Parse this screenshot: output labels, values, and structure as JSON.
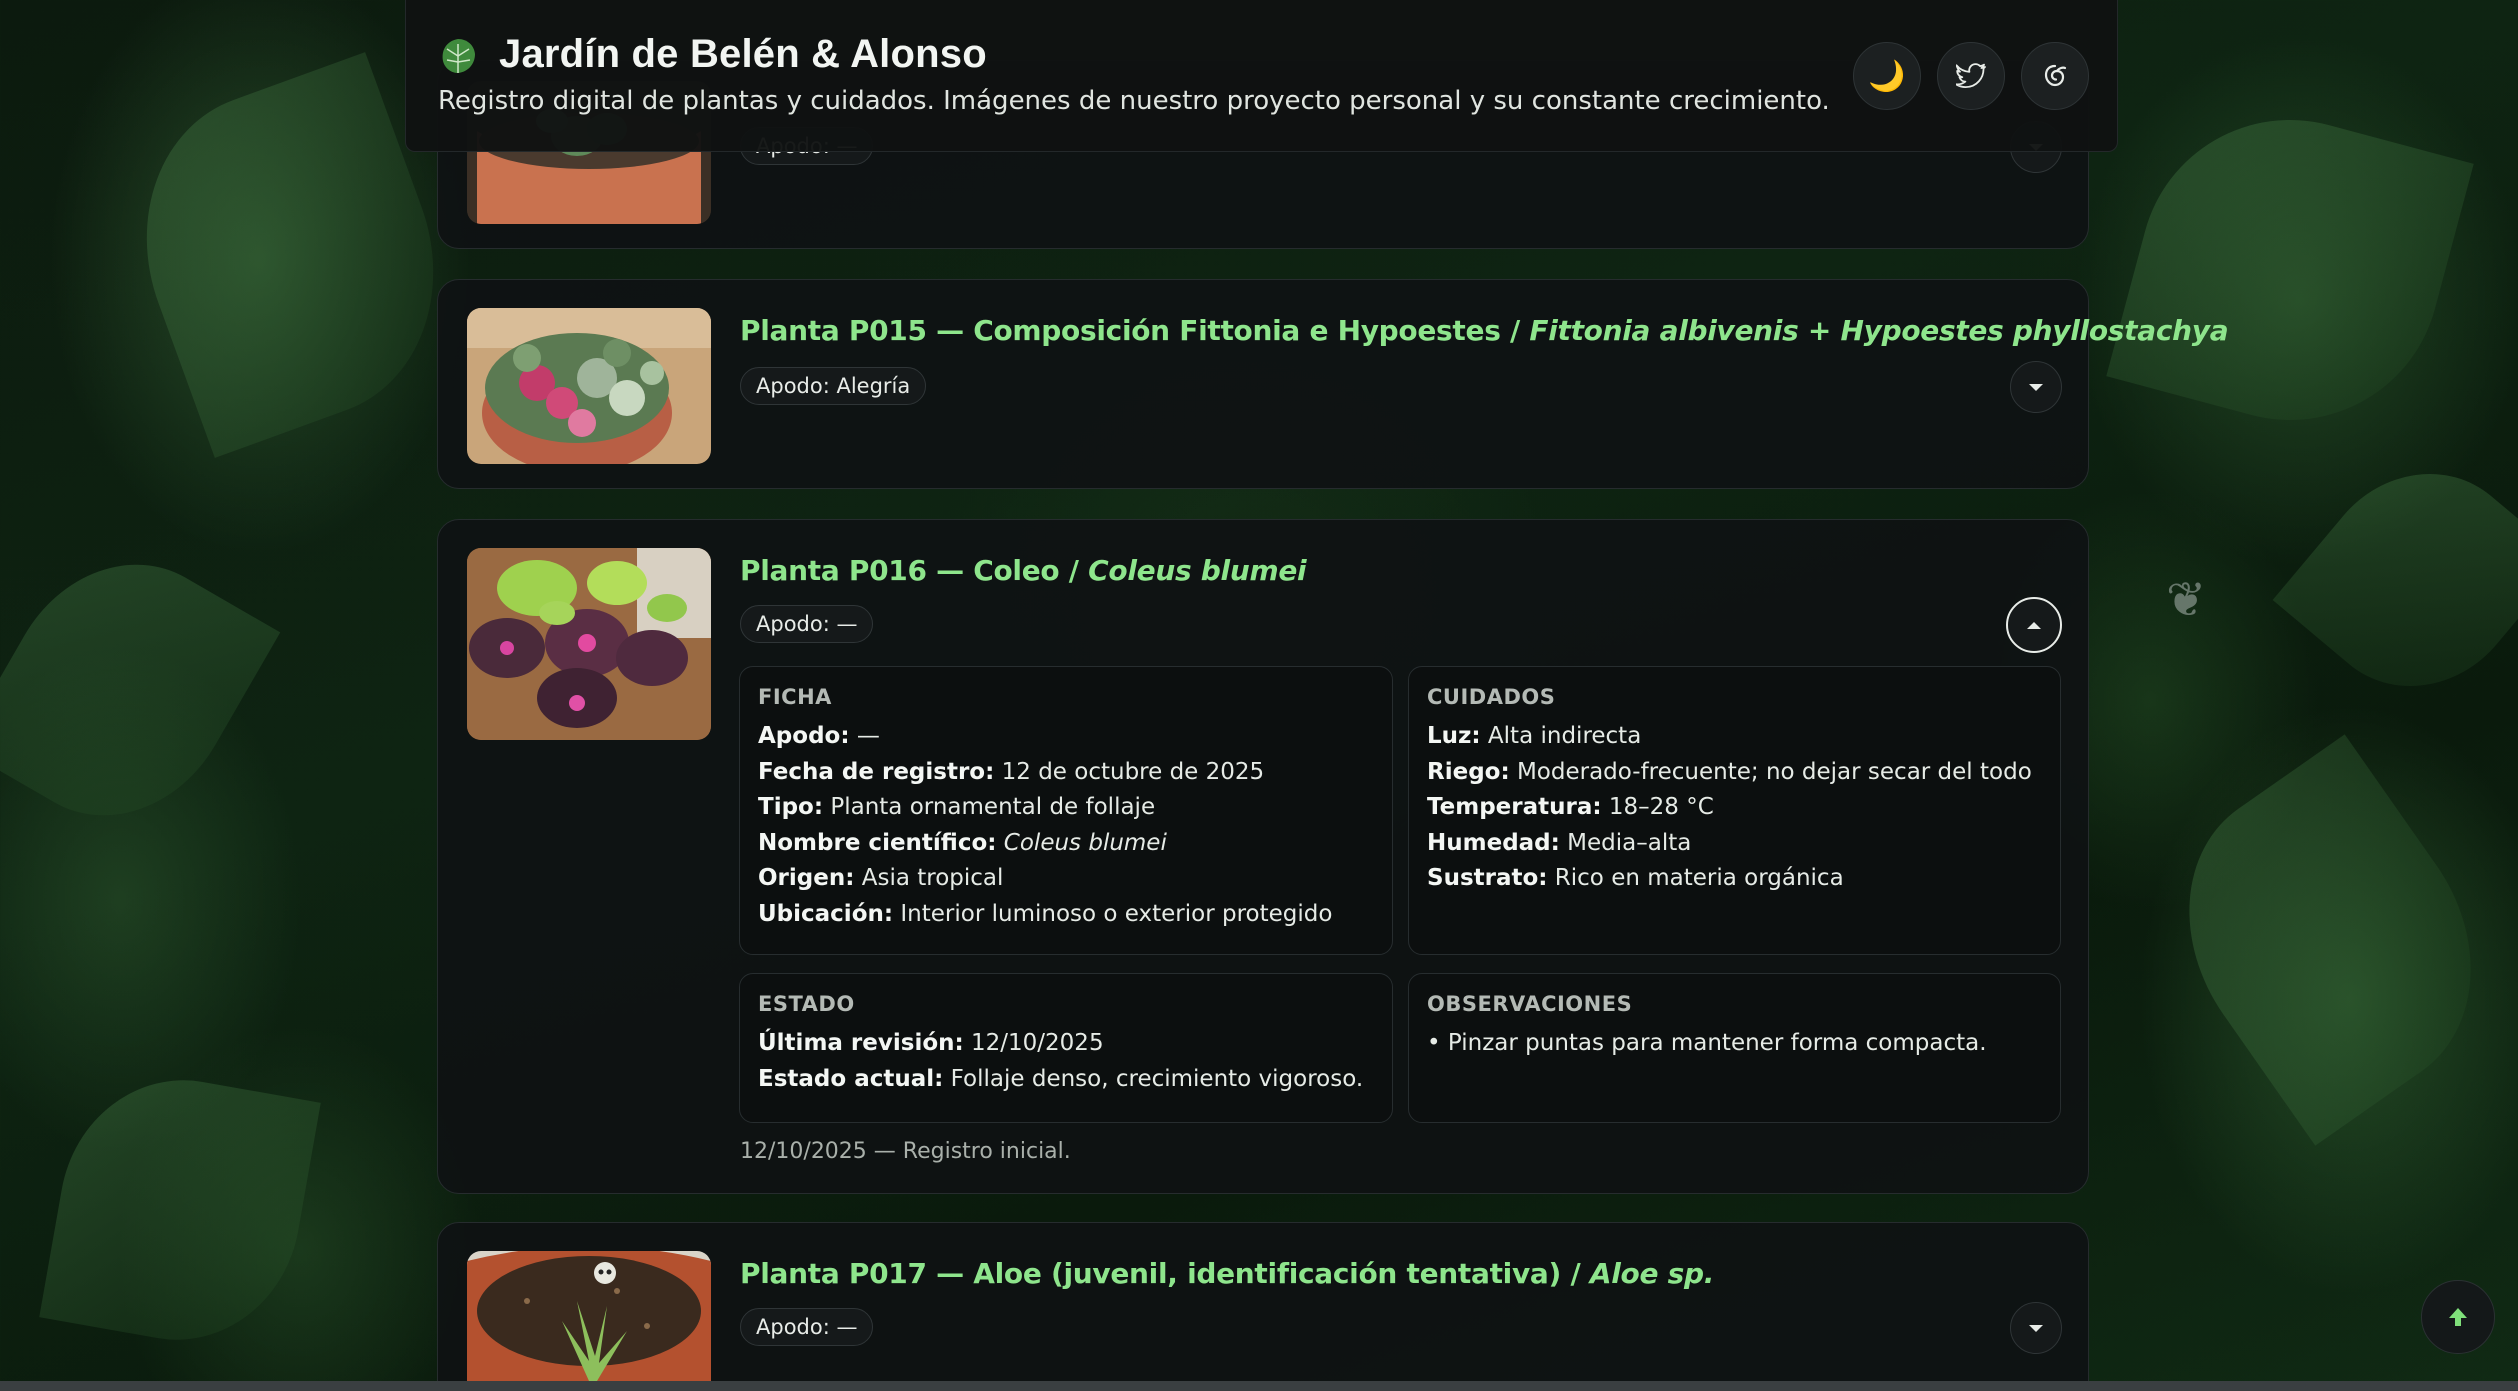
{
  "header": {
    "logo_icon": "monstera-leaf",
    "title": "Jardín de Belén & Alonso",
    "subtitle": "Registro digital de plantas y cuidados. Imágenes de nuestro proyecto personal y su constante crecimiento.",
    "buttons": [
      {
        "icon": "moon-icon",
        "glyph": "🌙"
      },
      {
        "icon": "twitter-icon",
        "glyph": ""
      },
      {
        "icon": "bluesky-icon",
        "glyph": ""
      }
    ]
  },
  "cards": {
    "p014": {
      "apodo": "Apodo: —"
    },
    "p015": {
      "title_prefix": "Planta P015 — Composición Fittonia e Hypoestes / ",
      "title_sci": "Fittonia albivenis + Hypoestes phyllostachya",
      "apodo": "Apodo: Alegría"
    },
    "p016": {
      "title_prefix": "Planta P016 — Coleo / ",
      "title_sci": "Coleus blumei",
      "apodo": "Apodo: —",
      "ficha": {
        "heading": "FICHA",
        "rows": [
          {
            "k": "Apodo:",
            "v": " —"
          },
          {
            "k": "Fecha de registro:",
            "v": " 12 de octubre de 2025"
          },
          {
            "k": "Tipo:",
            "v": " Planta ornamental de follaje"
          },
          {
            "k": "Nombre científico:",
            "v": "Coleus blumei"
          },
          {
            "k": "Origen:",
            "v": " Asia tropical"
          },
          {
            "k": "Ubicación:",
            "v": " Interior luminoso o exterior protegido"
          }
        ]
      },
      "cuidados": {
        "heading": "CUIDADOS",
        "rows": [
          {
            "k": "Luz:",
            "v": " Alta indirecta"
          },
          {
            "k": "Riego:",
            "v": " Moderado-frecuente; no dejar secar del todo"
          },
          {
            "k": "Temperatura:",
            "v": " 18–28 °C"
          },
          {
            "k": "Humedad:",
            "v": " Media–alta"
          },
          {
            "k": "Sustrato:",
            "v": " Rico en materia orgánica"
          }
        ]
      },
      "estado": {
        "heading": "ESTADO",
        "rows": [
          {
            "k": "Última revisión:",
            "v": " 12/10/2025"
          },
          {
            "k": "Estado actual:",
            "v": " Follaje denso, crecimiento vigoroso."
          }
        ]
      },
      "observaciones": {
        "heading": "OBSERVACIONES",
        "text": "• Pinzar puntas para mantener forma compacta."
      },
      "log": "12/10/2025 — Registro inicial."
    },
    "p017": {
      "title_prefix": "Planta P017 — Aloe (juvenil, identificación tentativa) / ",
      "title_sci": "Aloe sp.",
      "apodo": "Apodo: —"
    }
  },
  "back_to_top_icon": "arrow-up-icon",
  "colors": {
    "accent_green": "#8ee58c",
    "card_bg": "#0f1213",
    "page_bg": "#0e2412"
  }
}
